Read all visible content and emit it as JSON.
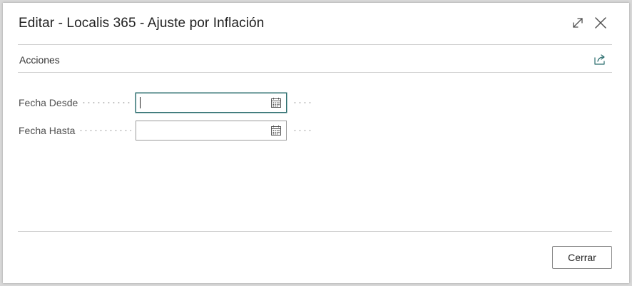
{
  "dialog": {
    "title": "Editar - Localis 365 - Ajuste por Inflación",
    "actions_label": "Acciones",
    "header_icons": [
      "expand-icon",
      "close-icon"
    ],
    "share_icon": "share-icon"
  },
  "fields": [
    {
      "label": "Fecha Desde",
      "value": "",
      "icon": "calendar-icon",
      "focused": true
    },
    {
      "label": "Fecha Hasta",
      "value": "",
      "icon": "calendar-icon",
      "focused": false
    }
  ],
  "footer": {
    "close_label": "Cerrar"
  },
  "colors": {
    "accent": "#2b6d6e",
    "border": "#9a9a9a",
    "divider": "#d0d0d0"
  }
}
